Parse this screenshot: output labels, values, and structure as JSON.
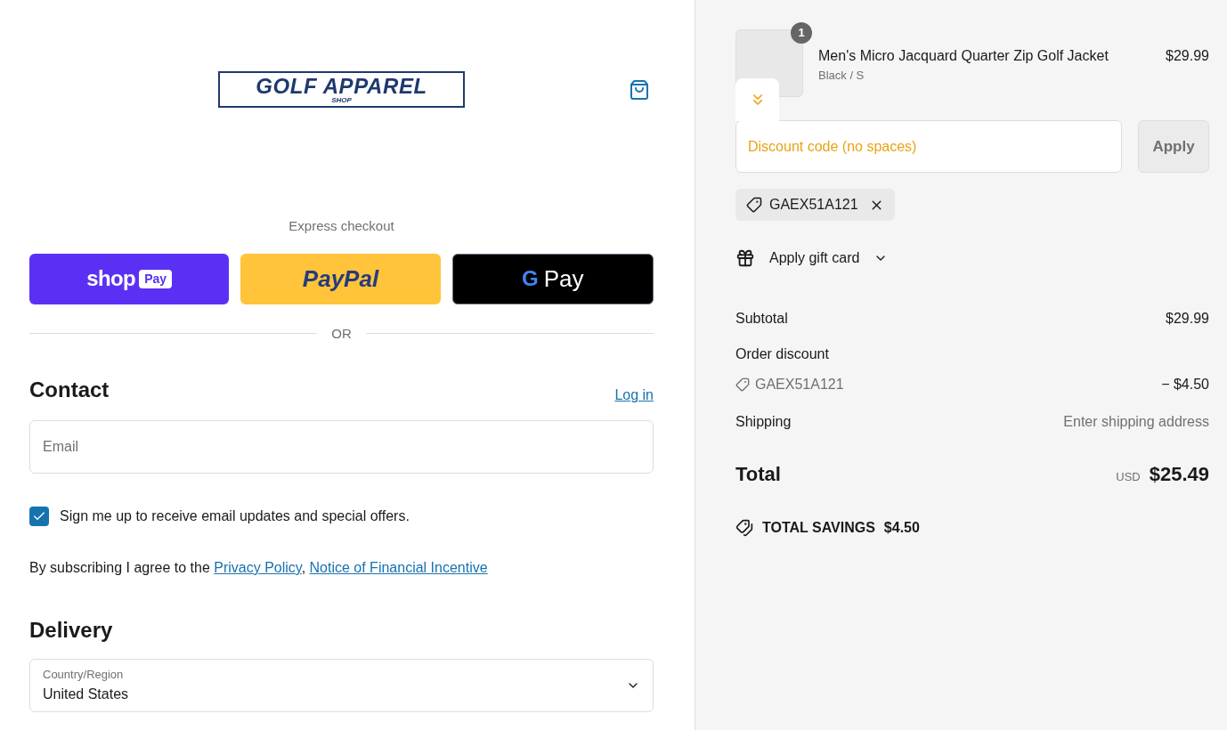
{
  "logo": {
    "name": "GOLF APPAREL",
    "tagline": "SHOP"
  },
  "express": {
    "title": "Express checkout",
    "buttons": [
      {
        "kind": "shop",
        "label": "shop",
        "tag": "Pay"
      },
      {
        "kind": "paypal",
        "label": "PayPal"
      },
      {
        "kind": "gpay",
        "label": "G",
        "tag": "Pay"
      }
    ],
    "divider": "OR"
  },
  "contact": {
    "title": "Contact",
    "login": "Log in",
    "email": {
      "placeholder": "Email"
    },
    "newsletter": {
      "label": "Sign me up to receive email updates and special offers.",
      "checked": true
    },
    "consent": {
      "text": "By subscribing I agree to the",
      "links": [
        "Privacy Policy",
        "Notice of Financial Incentive"
      ],
      "separator": ","
    }
  },
  "delivery": {
    "title": "Delivery",
    "country": {
      "label": "Country/Region",
      "value": "United States"
    }
  },
  "summary": {
    "item": {
      "quantity": "1",
      "name": "Men's Micro Jacquard Quarter Zip Golf Jacket",
      "variant": "Black / S",
      "price": "$29.99"
    },
    "discount": {
      "placeholder": "Discount code (no spaces)",
      "button": "Apply",
      "applied": "GAEX51A121"
    },
    "gift_card": {
      "label": "Apply gift card",
      "expanded": false
    },
    "lines": [
      {
        "label": "Subtotal",
        "value": "$29.99"
      },
      {
        "label": "Order discount"
      }
    ],
    "discount_line": {
      "code": "GAEX51A121",
      "value": "− $4.50"
    },
    "shipping": {
      "label": "Shipping",
      "value": "Enter shipping address"
    },
    "total": {
      "label": "Total",
      "currency": "USD",
      "value": "$25.49"
    },
    "savings": {
      "label": "TOTAL SAVINGS",
      "value": "$4.50"
    }
  }
}
